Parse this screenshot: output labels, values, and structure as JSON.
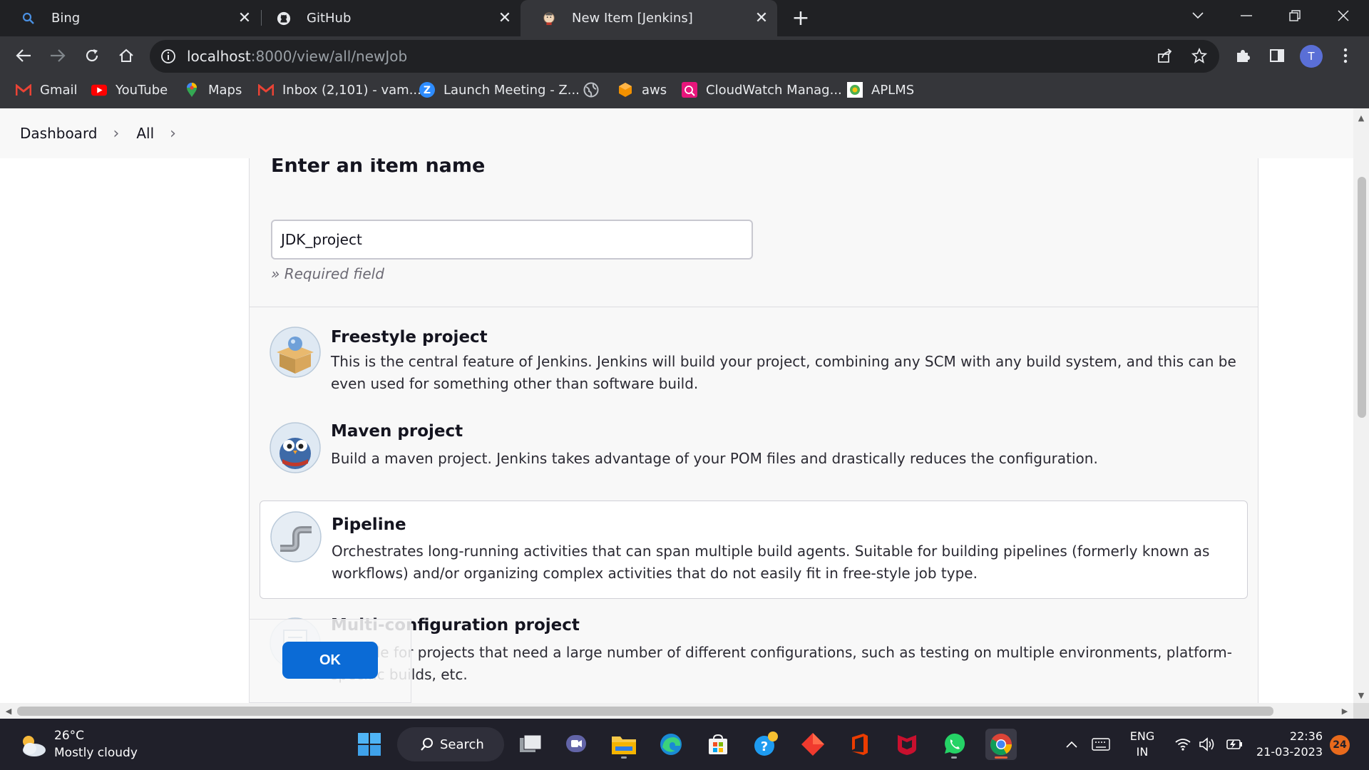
{
  "browser": {
    "tabs": [
      {
        "title": "Bing",
        "icon": "bing-search-icon",
        "close": "✕"
      },
      {
        "title": "GitHub",
        "icon": "github-icon",
        "close": "✕"
      },
      {
        "title": "New Item [Jenkins]",
        "icon": "jenkins-icon",
        "close": "✕"
      }
    ],
    "new_tab": "+",
    "address": {
      "host": "localhost",
      "path": ":8000/view/all/newJob"
    },
    "profile_initial": "T",
    "bookmarks": [
      {
        "label": "Gmail",
        "icon": "gmail-icon"
      },
      {
        "label": "YouTube",
        "icon": "youtube-icon"
      },
      {
        "label": "Maps",
        "icon": "maps-icon"
      },
      {
        "label": "Inbox (2,101) - vam...",
        "icon": "gmail-icon"
      },
      {
        "label": "Launch Meeting - Z...",
        "icon": "zoom-icon"
      },
      {
        "label": "",
        "icon": "globe-icon"
      },
      {
        "label": "aws",
        "icon": "aws-icon"
      },
      {
        "label": "CloudWatch Manag...",
        "icon": "cloudwatch-icon"
      },
      {
        "label": "APLMS",
        "icon": "aplms-icon"
      }
    ]
  },
  "breadcrumb": {
    "items": [
      "Dashboard",
      "All"
    ],
    "separator": "›"
  },
  "form": {
    "heading": "Enter an item name",
    "item_name_value": "JDK_project",
    "required_note": "» Required field",
    "ok_label": "OK"
  },
  "item_types": [
    {
      "name": "Freestyle project",
      "icon": "freestyle-project-icon",
      "selected": false,
      "description": "This is the central feature of Jenkins. Jenkins will build your project, combining any SCM with any build system, and this can be even used for something other than software build."
    },
    {
      "name": "Maven project",
      "icon": "maven-owl-icon",
      "selected": false,
      "description": "Build a maven project. Jenkins takes advantage of your POM files and drastically reduces the configuration."
    },
    {
      "name": "Pipeline",
      "icon": "pipeline-icon",
      "selected": true,
      "description": "Orchestrates long-running activities that can span multiple build agents. Suitable for building pipelines (formerly known as workflows) and/or organizing complex activities that do not easily fit in free-style job type."
    },
    {
      "name": "Multi-configuration project",
      "icon": "multi-configuration-icon",
      "selected": false,
      "description": "Suitable for projects that need a large number of different configurations, such as testing on multiple environments, platform-specific builds, etc."
    }
  ],
  "taskbar": {
    "weather": {
      "temp": "26°C",
      "desc": "Mostly cloudy"
    },
    "search_label": "Search",
    "lang": {
      "line1": "ENG",
      "line2": "IN"
    },
    "time": "22:36",
    "date": "21-03-2023",
    "notification_count": "24"
  },
  "colors": {
    "accent": "#0b6bd6",
    "chrome_dark": "#202124",
    "chrome_mid": "#35363a"
  }
}
